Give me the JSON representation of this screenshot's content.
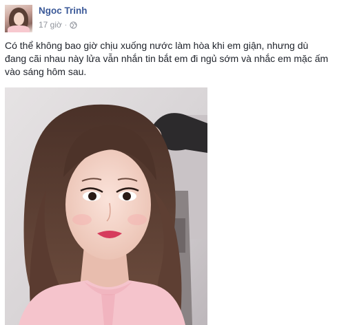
{
  "post": {
    "author_name": "Ngoc Trinh",
    "timestamp": "17 giờ",
    "separator": "·",
    "privacy_icon": "globe-icon",
    "text": "Có thể không bao giờ chịu xuống nước làm hòa khi em giận, nhưng dù đang cãi nhau này lửa vẫn nhắn tin bắt em đi ngủ sớm và nhắc em mặc ấm vào sáng hôm sau.",
    "colors": {
      "name": "#3b5998",
      "meta": "#90949c",
      "text": "#1d2129"
    }
  }
}
